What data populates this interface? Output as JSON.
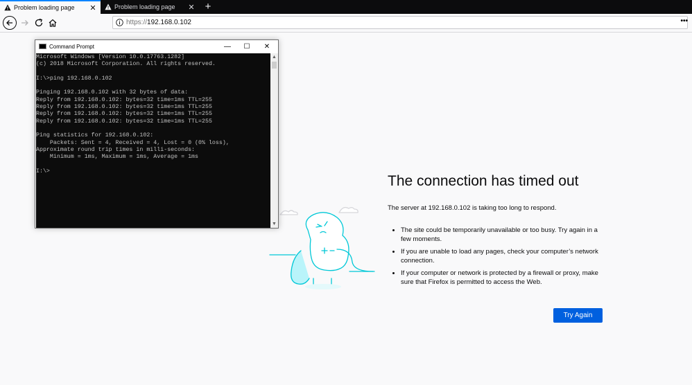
{
  "tabs": [
    {
      "title": "Problem loading page",
      "close": "✕"
    },
    {
      "title": "Problem loading page",
      "close": "✕"
    }
  ],
  "new_tab_label": "+",
  "urlbar": {
    "scheme": "https://",
    "host": "192.168.0.102",
    "more": "•••"
  },
  "cmd": {
    "title": "Command Prompt",
    "minimize": "—",
    "maximize": "☐",
    "close": "✕",
    "output": "Microsoft Windows [Version 10.0.17763.1282]\n(c) 2018 Microsoft Corporation. All rights reserved.\n\nI:\\>ping 192.168.0.102\n\nPinging 192.168.0.102 with 32 bytes of data:\nReply from 192.168.0.102: bytes=32 time=1ms TTL=255\nReply from 192.168.0.102: bytes=32 time=1ms TTL=255\nReply from 192.168.0.102: bytes=32 time=1ms TTL=255\nReply from 192.168.0.102: bytes=32 time=1ms TTL=255\n\nPing statistics for 192.168.0.102:\n    Packets: Sent = 4, Received = 4, Lost = 0 (0% loss),\nApproximate round trip times in milli-seconds:\n    Minimum = 1ms, Maximum = 1ms, Average = 1ms\n\nI:\\>"
  },
  "error": {
    "title": "The connection has timed out",
    "description": "The server at 192.168.0.102 is taking too long to respond.",
    "bullets": [
      "The site could be temporarily unavailable or too busy. Try again in a few moments.",
      "If you are unable to load any pages, check your computer’s network connection.",
      "If your computer or network is protected by a firewall or proxy, make sure that Firefox is permitted to access the Web."
    ],
    "try_again": "Try Again"
  },
  "colors": {
    "accent": "#0060df",
    "tab_highlight": "#0a84ff",
    "illustration": "#00c8d7"
  }
}
